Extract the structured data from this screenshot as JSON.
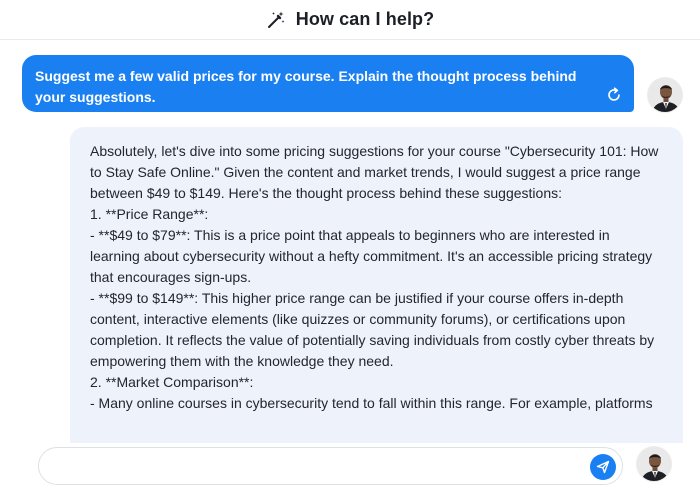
{
  "header": {
    "title": "How can I help?",
    "icon": "magic-wand-icon"
  },
  "user_message": {
    "text": "Suggest me a few valid prices for my course. Explain the thought process behind your suggestions.",
    "regenerate_icon": "regenerate-icon"
  },
  "assistant_message": {
    "lines": [
      "Absolutely, let's dive into some pricing suggestions for your course \"Cybersecurity 101: How to Stay Safe Online.\" Given the content and market trends, I would suggest a price range between $49 to $149. Here's the thought process behind these suggestions:",
      "",
      "1. **Price Range**:",
      "- **$49 to $79**: This is a price point that appeals to beginners who are interested in learning about cybersecurity without a hefty commitment. It's an accessible pricing strategy that encourages sign-ups.",
      "- **$99 to $149**: This higher price range can be justified if your course offers in-depth content, interactive elements (like quizzes or community forums), or certifications upon completion. It reflects the value of potentially saving individuals from costly cyber threats by empowering them with the knowledge they need.",
      "",
      "2. **Market Comparison**:",
      "- Many online courses in cybersecurity tend to fall within this range. For example, platforms"
    ]
  },
  "composer": {
    "value": "",
    "placeholder": "",
    "send_icon": "send-icon"
  },
  "colors": {
    "accent": "#1a80f2",
    "assistant_bg": "#eef2fa"
  }
}
